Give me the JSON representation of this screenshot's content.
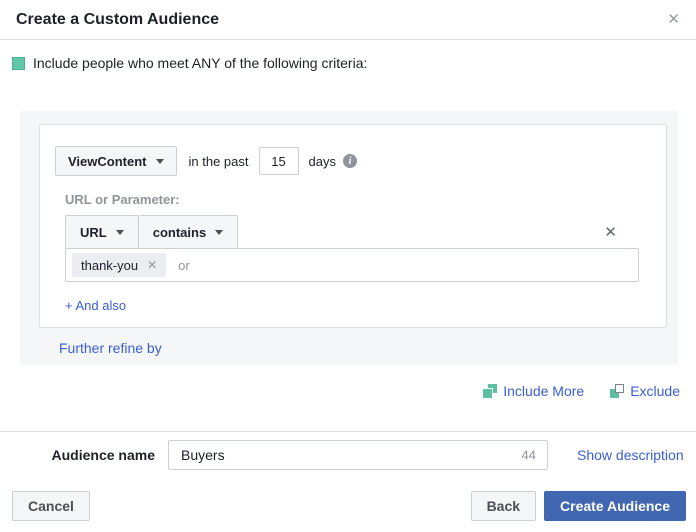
{
  "dialog": {
    "title": "Create a Custom Audience"
  },
  "icons": {
    "close_glyph": "✕",
    "remove_glyph": "✕",
    "chip_remove_glyph": "✕",
    "info_glyph": "i"
  },
  "intro": {
    "text": "Include people who meet ANY of the following criteria:"
  },
  "criteria": {
    "event_value": "ViewContent",
    "in_the_past_label": "in the past",
    "days_value": "15",
    "days_label": "days",
    "url_parameter_label": "URL or Parameter:",
    "field_value": "URL",
    "operator_value": "contains",
    "tag_value": "thank-you",
    "or_placeholder": "or",
    "and_also_link": "+ And also",
    "further_refine_link": "Further refine by"
  },
  "actions": {
    "include_more_link": "Include More",
    "exclude_link": "Exclude"
  },
  "audience": {
    "label": "Audience name",
    "value": "Buyers",
    "char_count": "44",
    "show_description_link": "Show description"
  },
  "footer": {
    "cancel_label": "Cancel",
    "back_label": "Back",
    "create_label": "Create Audience"
  },
  "colors": {
    "link_blue": "#3a5fd0",
    "button_blue": "#4267b2",
    "square_green": "#5ec8a8",
    "panel_grey": "#f5f6f7"
  }
}
